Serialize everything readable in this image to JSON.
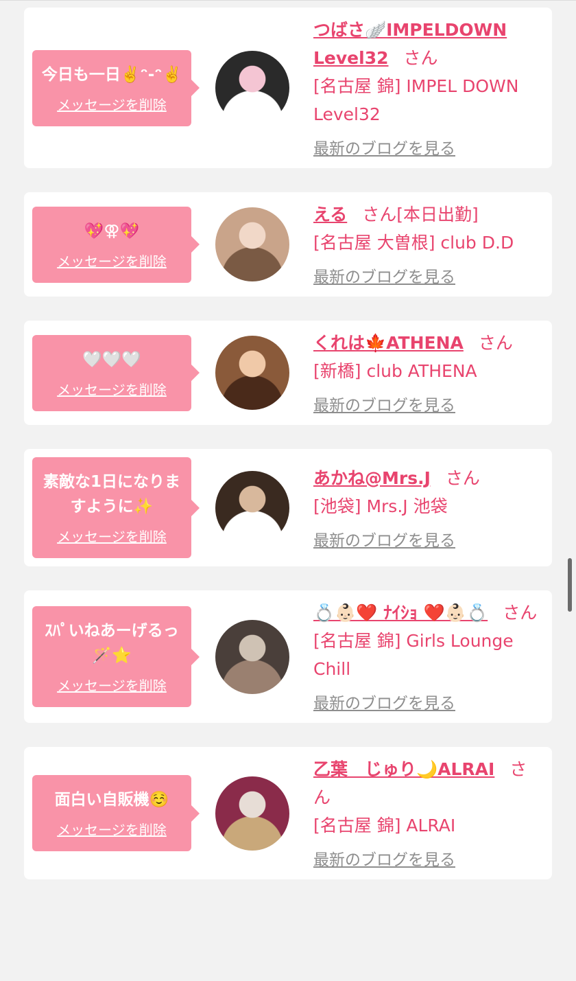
{
  "delete_label": "メッセージを削除",
  "blog_label": "最新のブログを見る",
  "san_label": "さん",
  "cards": [
    {
      "message": "今日も一日✌️ᵔ-ᵔ✌️",
      "name": "つばさ🪽IMPELDOWN Level32",
      "extra": "",
      "shop": "[名古屋 錦] IMPEL DOWN Level32",
      "avatar_colors": [
        "#2a2a2a",
        "#f4c5d3",
        "#ffffff"
      ]
    },
    {
      "message": "💖⚢💖",
      "name": "える",
      "extra": "[本日出勤]",
      "shop": "[名古屋 大曽根] club D.D",
      "avatar_colors": [
        "#c9a48a",
        "#f1d8c8",
        "#7a5a44"
      ]
    },
    {
      "message": "🤍🤍🤍",
      "name": "くれは🍁ATHENA",
      "extra": "",
      "shop": "[新橋] club ATHENA",
      "avatar_colors": [
        "#8a5a3a",
        "#f0c9a8",
        "#4a2a1a"
      ]
    },
    {
      "message": "素敵な1日になりますように✨",
      "name": "あかね@Mrs.J",
      "extra": "",
      "shop": "[池袋] Mrs.J 池袋",
      "avatar_colors": [
        "#3a2a20",
        "#d8b89c",
        "#ffffff"
      ]
    },
    {
      "message": "ｽﾊﾟいねあーげるっ🪄⭐️",
      "name": "💍👶🏻❤️ ﾅｲｼｮ ❤️👶🏻💍",
      "extra": "",
      "shop": "[名古屋 錦] Girls Lounge Chill",
      "avatar_colors": [
        "#4a3f3a",
        "#cfc2b4",
        "#9a8070"
      ]
    },
    {
      "message": "面白い自販機☺️",
      "name": "乙葉　じゅり🌙ALRAI",
      "extra": "",
      "shop": "[名古屋 錦] ALRAI",
      "avatar_colors": [
        "#8a2b4a",
        "#e7ddd6",
        "#c9a87a"
      ]
    }
  ]
}
